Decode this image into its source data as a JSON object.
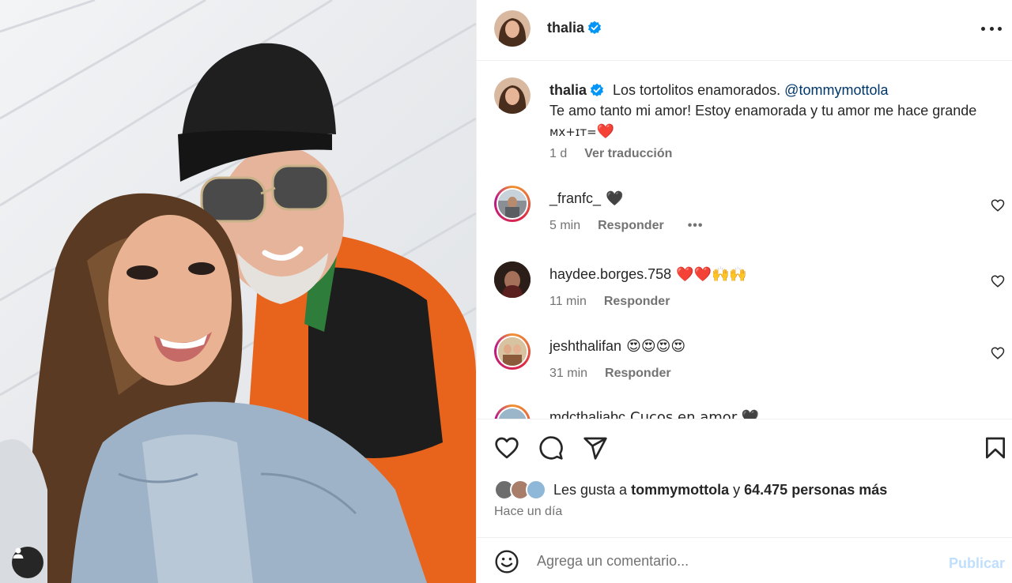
{
  "post": {
    "author": "thalia",
    "verified": true,
    "caption_text": "Los tortolitos enamorados.",
    "caption_mention": "@tommymottola",
    "caption_line2": "Te amo tanto mi amor! Estoy enamorada y tu amor me hace grande",
    "caption_flags": "ᴍx+ɪᴛ=",
    "caption_heart": "❤️",
    "caption_age": "1 d",
    "see_translation": "Ver traducción"
  },
  "comments": [
    {
      "username": "_franfc_",
      "text": "🖤",
      "time": "5 min",
      "reply": "Responder",
      "more": "•••",
      "avatar_color": "#8a8f96",
      "ring": true
    },
    {
      "username": "haydee.borges.758",
      "text": "❤️❤️🙌🙌",
      "time": "11 min",
      "reply": "Responder",
      "avatar_color": "#3a2a24",
      "ring": false
    },
    {
      "username": "jeshthalifan",
      "text": "😍😍😍😍",
      "time": "31 min",
      "reply": "Responder",
      "avatar_color": "#b08a5c",
      "ring": true
    },
    {
      "username": "mdcthaliabc",
      "text": "Cucos en amor 🖤",
      "time": "",
      "reply": "",
      "avatar_color": "#9bb6c9",
      "ring": true
    }
  ],
  "likes": {
    "prefix": "Les gusta a",
    "user": "tommymottola",
    "joiner": "y",
    "count_text": "64.475 personas más",
    "avatar_colors": [
      "#6d6d6d",
      "#a87e6a",
      "#8fb8d8"
    ]
  },
  "time_ago": "Hace un día",
  "add_comment": {
    "placeholder": "Agrega un comentario...",
    "publish_label": "Publicar"
  },
  "colors": {
    "accent_blue": "#0095f6",
    "publish_disabled": "#c0dffd",
    "mention": "#00376b",
    "verified": "#0095f6",
    "heart_red": "#ed4956"
  },
  "icons": {
    "header_more": "more-horizontal-icon",
    "like": "heart-icon",
    "comment": "comment-bubble-icon",
    "share": "paper-plane-icon",
    "save": "bookmark-icon",
    "emoji": "smiley-icon",
    "user_tag": "person-icon"
  }
}
